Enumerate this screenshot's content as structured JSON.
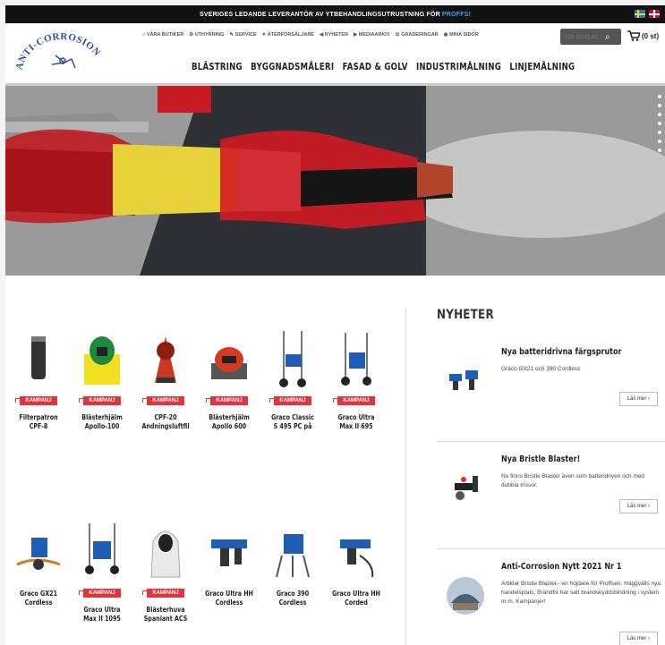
{
  "topbar": {
    "message": "SVERIGES LEDANDE LEVERANTÖR AV YTBEHANDLINGSUTRUSTNING FÖR",
    "highlight": "PROFFS!"
  },
  "header": {
    "logo_text": "ANTI-CORROSION",
    "utility": [
      {
        "label": "VÅRA BUTIKER",
        "icon": "home-icon"
      },
      {
        "label": "UTHYRNING",
        "icon": "cog-icon"
      },
      {
        "label": "SERVICE",
        "icon": "wrench-icon"
      },
      {
        "label": "ÅTERFÖRSÄLJARE",
        "icon": "handshake-icon"
      },
      {
        "label": "NYHETER",
        "icon": "bullhorn-icon"
      },
      {
        "label": "MEDIAARKIV",
        "icon": "video-icon"
      },
      {
        "label": "GRADERINGAR",
        "icon": "scale-icon"
      },
      {
        "label": "MINA SIDOR",
        "icon": "user-icon"
      }
    ],
    "search_placeholder": "Sök produkt",
    "cart_label": "(0 st)",
    "mainnav": [
      "BLÄSTRING",
      "BYGGNADSMÅLERI",
      "FASAD & GOLV",
      "INDUSTRIMÅLNING",
      "LINJEMÅLNING"
    ]
  },
  "badge_label": "KAMPANJ",
  "products": [
    {
      "name": "Filterpatron CPF-8",
      "campaign": true
    },
    {
      "name": "Blästerhjälm Apollo-100",
      "campaign": true
    },
    {
      "name": "CPF-20 Andningsluftfil",
      "campaign": true
    },
    {
      "name": "Blästerhjälm Apollo 600",
      "campaign": true
    },
    {
      "name": "Graco Classic S 495 PC på",
      "campaign": true
    },
    {
      "name": "Graco Ultra Max II 695",
      "campaign": true
    },
    {
      "name": "Graco GX21 Cordless",
      "campaign": false
    },
    {
      "name": "Graco Ultra Max II 1095",
      "campaign": true
    },
    {
      "name": "Blästerhuva Spaniant ACS",
      "campaign": true
    },
    {
      "name": "Graco Ultra HH Cordless",
      "campaign": false
    },
    {
      "name": "Graco 390 Cordless",
      "campaign": false
    },
    {
      "name": "Graco Ultra HH Corded",
      "campaign": false
    }
  ],
  "news": {
    "heading": "NYHETER",
    "more_label": "Läs mer ›",
    "items": [
      {
        "title": "Nya batteridrivna färgsprutor",
        "text": "Graco GX21 och 390 Cordless"
      },
      {
        "title": "Nya Bristle Blaster!",
        "text": "Nu finns Bristle Blaster även som batteridriven och med dubbla trissor."
      },
      {
        "title": "Anti-Corrosion Nytt 2021 Nr 1",
        "text": "Artiklar Bristle Blaster– en höjdare för Proffsen, Häggvälls nya handelsplats, Brandfix har satt brandskyddsbindning i system m.m. Kampanjer!"
      }
    ]
  },
  "colors": {
    "accent": "#e0353d",
    "topbar": "#111111",
    "pro": "#3aa6ff"
  }
}
